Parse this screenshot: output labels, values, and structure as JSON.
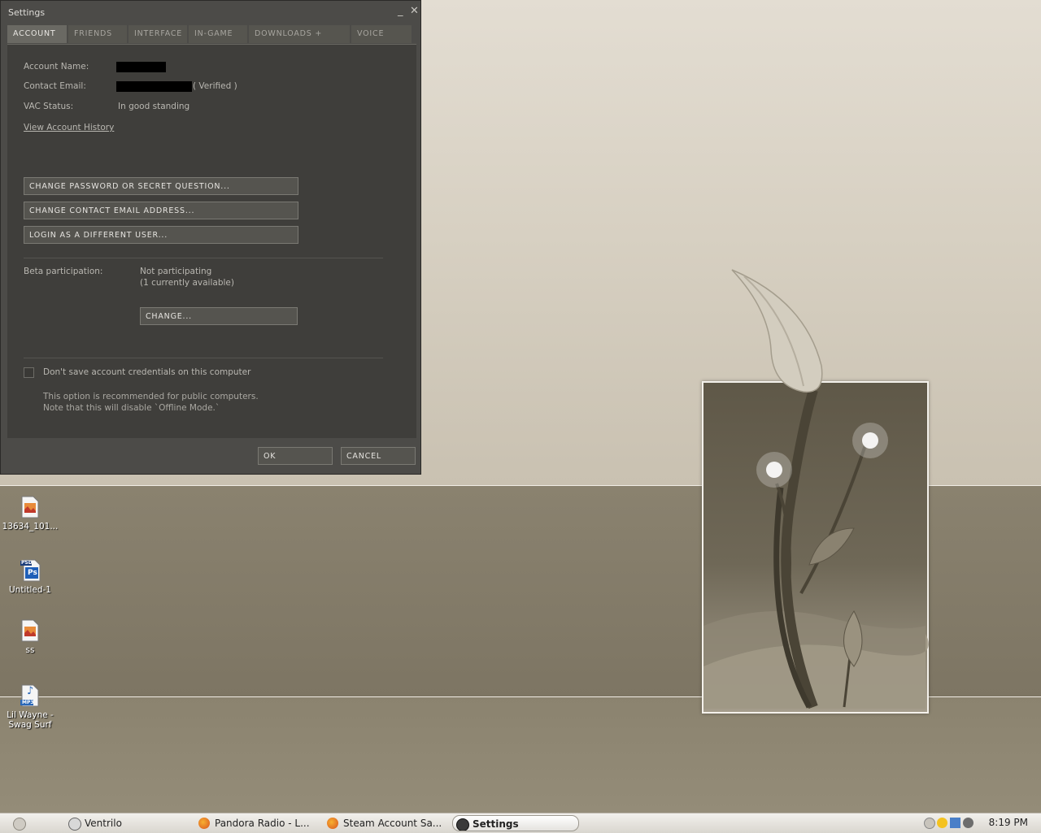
{
  "window": {
    "title": "Settings",
    "minimize_glyph": "_",
    "close_glyph": "✕",
    "tabs": [
      {
        "label": "ACCOUNT",
        "active": true
      },
      {
        "label": "FRIENDS",
        "active": false
      },
      {
        "label": "INTERFACE",
        "active": false
      },
      {
        "label": "IN-GAME",
        "active": false
      },
      {
        "label": "DOWNLOADS + CLOUD",
        "active": false
      },
      {
        "label": "VOICE",
        "active": false
      }
    ],
    "account": {
      "account_name_label": "Account Name:",
      "contact_email_label": "Contact Email:",
      "verified_text": "( Verified )",
      "vac_label": "VAC Status:",
      "vac_value": "In good standing",
      "history_link": "View Account History",
      "change_password_btn": "CHANGE PASSWORD OR SECRET QUESTION...",
      "change_email_btn": "CHANGE CONTACT EMAIL ADDRESS...",
      "login_different_btn": "LOGIN AS A DIFFERENT USER...",
      "beta_label": "Beta participation:",
      "beta_value_1": "Not participating",
      "beta_value_2": "(1 currently available)",
      "change_btn": "CHANGE...",
      "credentials_checkbox": "Don't save account credentials on this computer",
      "note_1": "This option is recommended for public computers.",
      "note_2": "Note that this will disable `Offline Mode.`"
    },
    "ok_btn": "OK",
    "cancel_btn": "CANCEL"
  },
  "desktop_icons": [
    {
      "label": "13634_101...",
      "type": "image-file-icon"
    },
    {
      "label": "Untitled-1",
      "type": "photoshop-file-icon",
      "badge": "PSD",
      "glyph": "Ps"
    },
    {
      "label": "ss",
      "type": "image-file-icon"
    },
    {
      "label": "Lil Wayne - Swag Surf",
      "type": "mp3-file-icon",
      "badge": "MP3",
      "glyph": "♪"
    }
  ],
  "taskbar": {
    "items": [
      {
        "label": "Ventrilo",
        "icon": "ventrilo-icon",
        "active": false
      },
      {
        "label": "Pandora Radio - L...",
        "icon": "firefox-icon",
        "active": false
      },
      {
        "label": "Steam Account Sa...",
        "icon": "firefox-icon",
        "active": false
      },
      {
        "label": "Settings",
        "icon": "steam-icon",
        "active": true
      }
    ],
    "clock": "8:19 PM"
  }
}
